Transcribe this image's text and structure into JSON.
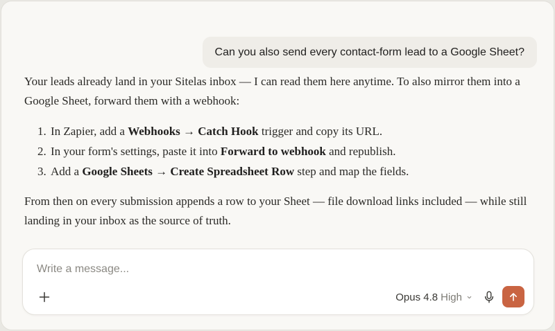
{
  "conversation": {
    "user_message": "Can you also send every contact-form lead to a Google Sheet?",
    "response": {
      "intro": "Your leads already land in your Sitelas inbox — I can read them here anytime. To also mirror them into a Google Sheet, forward them with a webhook:",
      "steps": [
        {
          "pre": "In Zapier, add a ",
          "bold1": "Webhooks → Catch Hook",
          "post": " trigger and copy its URL."
        },
        {
          "pre": "In your form's settings, paste it into ",
          "bold1": "Forward to webhook",
          "post": " and republish."
        },
        {
          "pre": "Add a ",
          "bold1": "Google Sheets → Create Spreadsheet Row",
          "post": " step and map the fields."
        }
      ],
      "outro": "From then on every submission appends a row to your Sheet — file download links included — while still landing in your inbox as the source of truth."
    }
  },
  "composer": {
    "placeholder": "Write a message...",
    "value": "",
    "model_name": "Opus 4.8",
    "effort": "High",
    "icons": {
      "add": "plus-icon",
      "model_menu": "chevron-down-icon",
      "voice": "microphone-icon",
      "send": "arrow-up-icon"
    }
  },
  "colors": {
    "background": "#f9f8f5",
    "user_bubble": "#efede8",
    "send_button": "#c96442",
    "text": "#2a2926"
  }
}
